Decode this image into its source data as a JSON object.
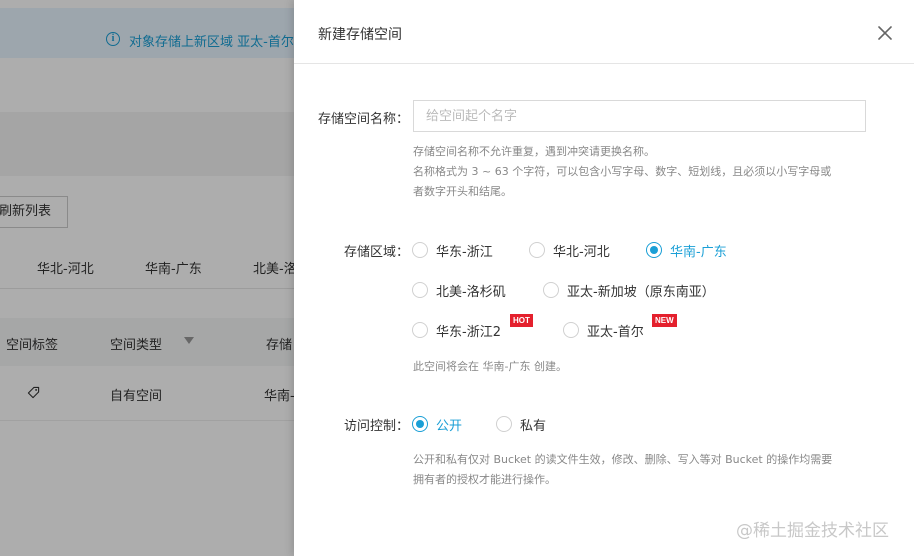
{
  "background": {
    "notice": {
      "icon": "info-icon",
      "icon_glyph": "i",
      "text": "对象存储上新区域 亚太-首尔"
    },
    "refresh_label": "刷新列表",
    "region_tabs": [
      "华北-河北",
      "华南-广东",
      "北美-洛"
    ],
    "table": {
      "headers": [
        "空间标签",
        "空间类型",
        "存储"
      ],
      "row": {
        "type": "自有空间",
        "region": "华南-"
      }
    }
  },
  "drawer": {
    "title": "新建存储空间",
    "close_icon": "close-icon",
    "name": {
      "label": "存储空间名称：",
      "placeholder": "给空间起个名字",
      "value": "",
      "help_line1": "存储空间名称不允许重复，遇到冲突请更换名称。",
      "help_line2": "名称格式为 3 ~ 63 个字符，可以包含小写字母、数字、短划线，且必须以小写字母或",
      "help_line3": "者数字开头和结尾。"
    },
    "region": {
      "label": "存储区域：",
      "options": [
        {
          "label": "华东-浙江",
          "checked": false
        },
        {
          "label": "华北-河北",
          "checked": false
        },
        {
          "label": "华南-广东",
          "checked": true
        },
        {
          "label": "北美-洛杉矶",
          "checked": false
        },
        {
          "label": "亚太-新加坡（原东南亚）",
          "checked": false
        },
        {
          "label": "华东-浙江2",
          "checked": false,
          "badge": "HOT"
        },
        {
          "label": "亚太-首尔",
          "checked": false,
          "badge": "NEW"
        }
      ],
      "note": "此空间将会在 华南-广东 创建。"
    },
    "access": {
      "label": "访问控制：",
      "options": [
        {
          "label": "公开",
          "checked": true
        },
        {
          "label": "私有",
          "checked": false
        }
      ],
      "help_line1": "公开和私有仅对 Bucket 的读文件生效，修改、删除、写入等对 Bucket 的操作均需要",
      "help_line2": "拥有者的授权才能进行操作。"
    }
  },
  "watermark": "@稀土掘金技术社区",
  "colors": {
    "accent": "#1a9fd6",
    "badge": "#e4202d"
  }
}
